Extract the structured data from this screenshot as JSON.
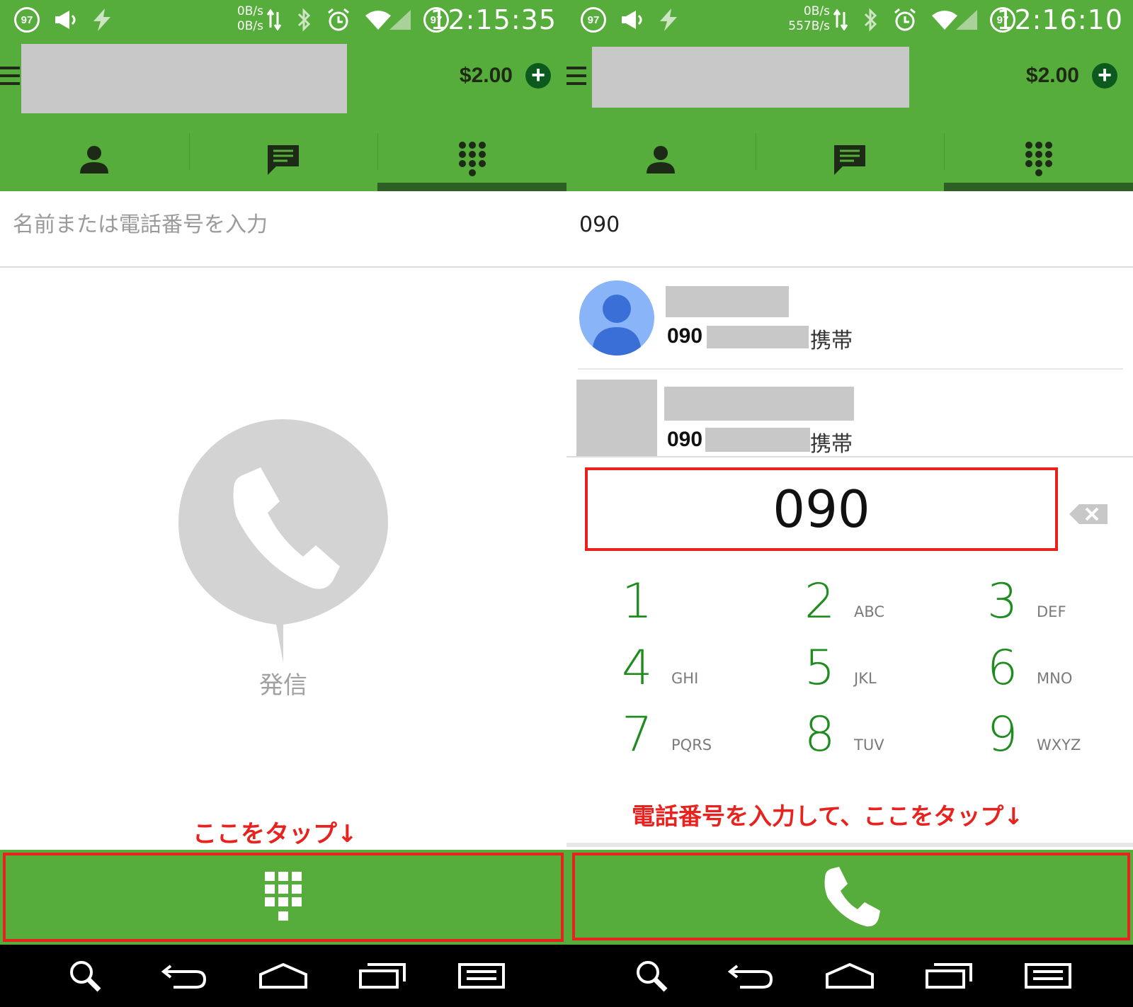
{
  "left": {
    "status": {
      "badge1": "97",
      "net_up": "0B/s",
      "net_down": "0B/s",
      "badge2": "97",
      "time": "12:15:35"
    },
    "header": {
      "balance": "$2.00"
    },
    "search": {
      "placeholder": "名前または電話番号を入力",
      "value": ""
    },
    "empty_label": "発信",
    "annotation": "ここをタップ↓"
  },
  "right": {
    "status": {
      "badge1": "97",
      "net_up": "0B/s",
      "net_down": "557B/s",
      "badge2": "97",
      "time": "12:16:10"
    },
    "header": {
      "balance": "$2.00"
    },
    "search": {
      "placeholder": "",
      "value": "090"
    },
    "contacts": [
      {
        "number_prefix": "090",
        "type": "携帯"
      },
      {
        "number_prefix": "090",
        "type": "携帯"
      }
    ],
    "dial_display": "090",
    "keypad": [
      {
        "digit": "1",
        "letters": ""
      },
      {
        "digit": "2",
        "letters": "ABC"
      },
      {
        "digit": "3",
        "letters": "DEF"
      },
      {
        "digit": "4",
        "letters": "GHI"
      },
      {
        "digit": "5",
        "letters": "JKL"
      },
      {
        "digit": "6",
        "letters": "MNO"
      },
      {
        "digit": "7",
        "letters": "PQRS"
      },
      {
        "digit": "8",
        "letters": "TUV"
      },
      {
        "digit": "9",
        "letters": "WXYZ"
      }
    ],
    "annotation": "電話番号を入力して、ここをタップ↓"
  },
  "icons": {
    "tabs": [
      "person-icon",
      "chat-icon",
      "dialpad-icon"
    ],
    "nav": [
      "search-icon",
      "back-icon",
      "home-icon",
      "recents-icon",
      "menu-icon"
    ]
  },
  "colors": {
    "app_green": "#56ad3b",
    "dark_green": "#2d5e23",
    "digit_green": "#1f8c1f",
    "annotation_red": "#e8231f"
  }
}
